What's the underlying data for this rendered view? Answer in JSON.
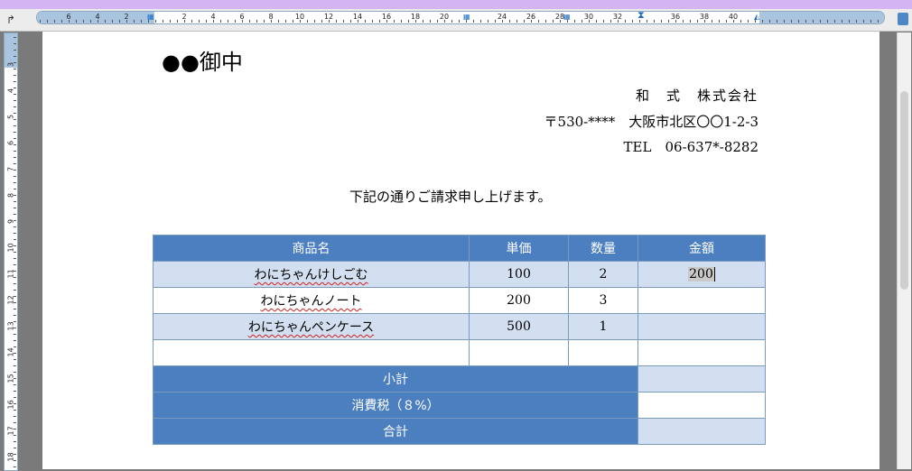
{
  "colors": {
    "header_blue": "#4c7fc0",
    "row_light_blue": "#d2dff0",
    "ruler_margin": "#a9c4de",
    "top_strip": "#d4b4f2"
  },
  "ruler": {
    "horizontal_labels": [
      "6",
      "4",
      "2",
      "2",
      "4",
      "6",
      "8",
      "10",
      "12",
      "14",
      "16",
      "18",
      "20",
      "24",
      "26",
      "28",
      "30",
      "32",
      "36",
      "38",
      "40"
    ],
    "vertical_labels": [
      "3",
      "4",
      "5",
      "6",
      "7",
      "8",
      "9",
      "10",
      "11",
      "12",
      "13",
      "14",
      "15",
      "16",
      "17",
      "18"
    ]
  },
  "document": {
    "title": "●●御中",
    "company": "和　式　株式会社",
    "address": "〒530-****　大阪市北区〇〇1-2-3",
    "tel": "TEL　06-637*-8282",
    "intro": "下記の通りご請求申し上げます。"
  },
  "invoice": {
    "headers": [
      "商品名",
      "単価",
      "数量",
      "金額"
    ],
    "rows": [
      {
        "name": "わにちゃんけしごむ",
        "price": "100",
        "qty": "2",
        "amount": "200"
      },
      {
        "name": "わにちゃんノート",
        "price": "200",
        "qty": "3",
        "amount": ""
      },
      {
        "name": "わにちゃんペンケース",
        "price": "500",
        "qty": "1",
        "amount": ""
      },
      {
        "name": "",
        "price": "",
        "qty": "",
        "amount": ""
      }
    ],
    "subtotal_label": "小計",
    "tax_label": "消費税（８%）",
    "total_label": "合計"
  }
}
